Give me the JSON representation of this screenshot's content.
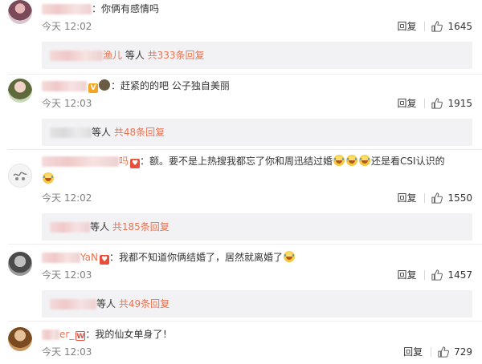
{
  "comments": [
    {
      "name_visible": "",
      "separator": "：",
      "text": "你俩有感情吗",
      "time": "今天 12:02",
      "reply_label": "回复",
      "likes": "1645",
      "replies_prefix_visible": "渔儿",
      "replies_mid": " 等人 ",
      "replies_count": "共333条回复"
    },
    {
      "name_visible": "",
      "separator": "：",
      "text": "赶紧的的吧 公子独自美丽",
      "time": "今天 12:03",
      "reply_label": "回复",
      "likes": "1915",
      "replies_prefix_visible": "",
      "replies_mid": "等人 ",
      "replies_count": "共48条回复"
    },
    {
      "name_visible": "吗",
      "separator": "：",
      "text_a": "额。要不是上热搜我都忘了你和周迅结过婚",
      "text_b": "还是看CSI认识的",
      "time": "今天 12:02",
      "reply_label": "回复",
      "likes": "1550",
      "replies_prefix_visible": "",
      "replies_mid": "等人 ",
      "replies_count": "共185条回复"
    },
    {
      "name_visible": "YaN",
      "separator": "：",
      "text": "我都不知道你俩结婚了，居然就离婚了",
      "time": "今天 12:03",
      "reply_label": "回复",
      "likes": "1457",
      "replies_prefix_visible": "",
      "replies_mid": "等人 ",
      "replies_count": "共49条回复"
    },
    {
      "name_visible": "er_",
      "separator": "：",
      "text": "我的仙女单身了！",
      "time": "今天 12:03",
      "reply_label": "回复",
      "likes": "729"
    }
  ],
  "icons": {
    "like": "thumbs-up-icon",
    "emoji": "laugh-cry-emoji-icon",
    "vip": "vip-badge-icon"
  },
  "colors": {
    "username": "#eb7350",
    "reply_count": "#eb7350",
    "meta": "#808080",
    "reply_box_bg": "#f2f2f5"
  }
}
